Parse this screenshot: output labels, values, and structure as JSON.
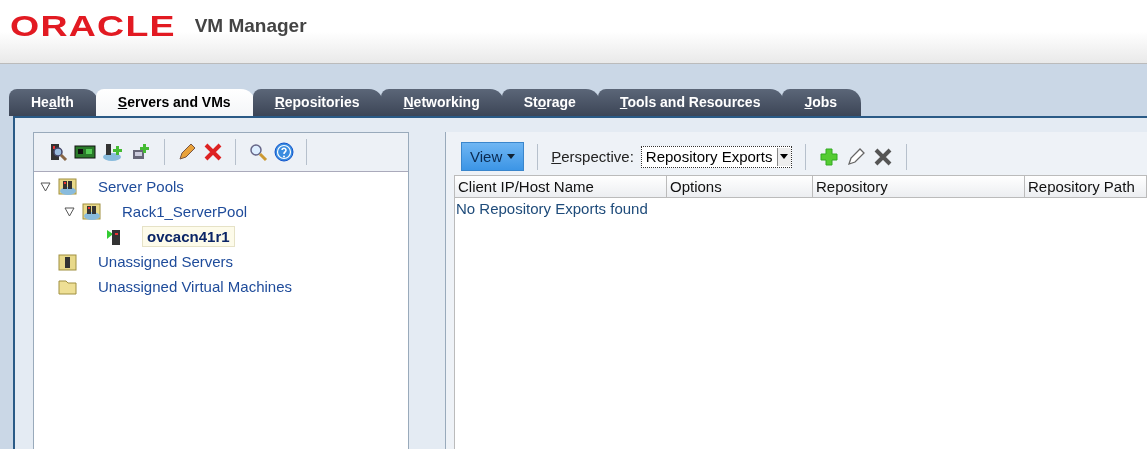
{
  "header": {
    "logo": "ORACLE",
    "title": "VM Manager"
  },
  "tabs": [
    {
      "pre": "He",
      "key": "a",
      "post": "lth",
      "selected": false
    },
    {
      "key": "S",
      "post": "ervers and VMs",
      "selected": true
    },
    {
      "key": "R",
      "post": "epositories",
      "selected": false
    },
    {
      "key": "N",
      "post": "etworking",
      "selected": false
    },
    {
      "pre": "St",
      "key": "o",
      "post": "rage",
      "selected": false
    },
    {
      "key": "T",
      "post": "ools and Resources",
      "selected": false
    },
    {
      "key": "J",
      "post": "obs",
      "selected": false
    }
  ],
  "tree": [
    {
      "label": "Server Pools",
      "kind": "pool",
      "expanded": true,
      "selected": false,
      "children": [
        {
          "label": "Rack1_ServerPool",
          "kind": "pool",
          "expanded": true,
          "selected": false,
          "children": [
            {
              "label": "ovcacn41r1",
              "kind": "server",
              "selected": true
            }
          ]
        }
      ]
    },
    {
      "label": "Unassigned Servers",
      "kind": "servers-folder",
      "selected": false
    },
    {
      "label": "Unassigned Virtual Machines",
      "kind": "folder",
      "selected": false
    }
  ],
  "toolbar": {
    "view": "View",
    "perspective_key": "P",
    "perspective_post": "erspective:",
    "perspective_value": "Repository Exports"
  },
  "table": {
    "columns": [
      "Client IP/Host Name",
      "Options",
      "Repository",
      "Repository Path"
    ],
    "empty_message": "No Repository Exports found"
  }
}
